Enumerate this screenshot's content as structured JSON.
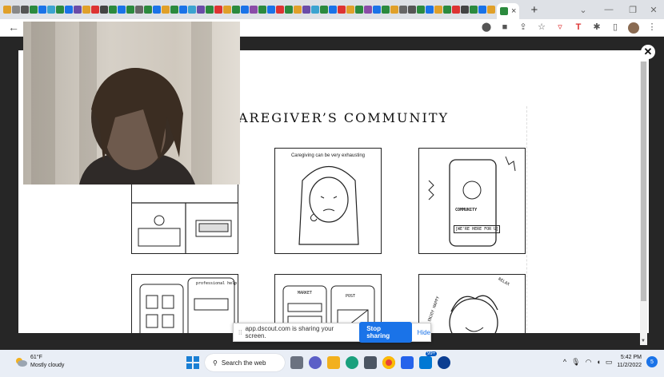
{
  "browser": {
    "tab_close": "×",
    "new_tab": "+",
    "window_controls": {
      "chevron": "⌄",
      "minimize": "—",
      "restore": "❐",
      "close": "✕"
    },
    "back": "←",
    "favicon_colors": [
      "#e0a02a",
      "#888888",
      "#555555",
      "#2b8a3e",
      "#1a73e8",
      "#3ba3d0",
      "#2b8a3e",
      "#1a73e8",
      "#6a4ca8",
      "#e0a02a",
      "#d33",
      "#444",
      "#2b8a3e",
      "#1a73e8",
      "#2b8a3e",
      "#666",
      "#2b8a3e",
      "#1a73e8",
      "#e0a02a",
      "#2b8a3e",
      "#1a73e8",
      "#3ba3d0",
      "#6a4ca8",
      "#2b8a3e",
      "#d33",
      "#e0a02a",
      "#2b8a3e",
      "#1a73e8",
      "#8a4ca8",
      "#2b8a3e",
      "#1a73e8",
      "#d33",
      "#2b8a3e",
      "#e0a02a",
      "#6a4ca8",
      "#3ba3d0",
      "#2b8a3e",
      "#1a73e8",
      "#d33",
      "#e0a02a",
      "#2b8a3e",
      "#8a4ca8",
      "#1a73e8",
      "#2b8a3e",
      "#e0a02a",
      "#666",
      "#555",
      "#2b8a3e",
      "#1a73e8",
      "#e0a02a",
      "#2b8a3e",
      "#d33",
      "#444",
      "#2b8a3e",
      "#1a73e8",
      "#e0a02a"
    ],
    "toolbar_icons": [
      "location-icon",
      "camera-icon",
      "share-icon",
      "star-icon",
      "pocket-icon",
      "tp-icon",
      "extensions-icon",
      "sidebar-icon"
    ]
  },
  "page": {
    "close": "✕",
    "headline": "AREGIVER’S COMMUNITY",
    "panel2_caption": "Caregiving can be very exhausting",
    "community_label": "COMMUNITY",
    "join_label": "[WE'RE HERE FOR U]",
    "market_label": "MARKET",
    "post_label": "POST",
    "relax_label": "RELAX",
    "enjoy_label": "ENJOY HAPPY",
    "professional_label": "professional help"
  },
  "share_bar": {
    "grip": "⁞⁞",
    "message": "app.dscout.com is sharing your screen.",
    "stop": "Stop sharing",
    "hide": "Hide"
  },
  "taskbar": {
    "temperature": "61°F",
    "condition": "Mostly cloudy",
    "search": "Search the web",
    "badge": "99+",
    "time": "5:42 PM",
    "date": "11/2/2022",
    "notifications": "5",
    "tray_chevron": "^",
    "tray_icons": [
      "mic-icon",
      "wifi-icon",
      "volume-icon",
      "battery-icon"
    ]
  }
}
